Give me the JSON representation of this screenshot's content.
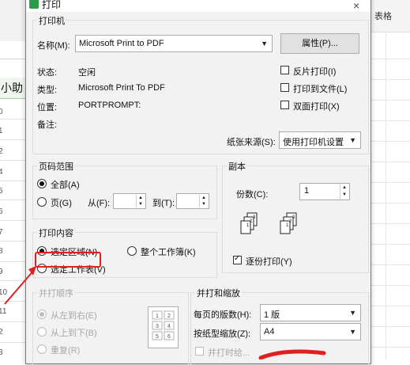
{
  "background": {
    "left_label": "小助",
    "row_numbers": [
      "0",
      "1",
      "2",
      "4",
      "5",
      "6",
      "7",
      "8",
      "9",
      "10",
      "11",
      "2",
      "3",
      "4"
    ],
    "right_label": "表格"
  },
  "dialog": {
    "title": "打印",
    "close": "×"
  },
  "printer": {
    "legend": "打印机",
    "name_label": "名称(M):",
    "name_value": "Microsoft Print to PDF",
    "properties_button": "属性(P)...",
    "status_label": "状态:",
    "status_value": "空闲",
    "type_label": "类型:",
    "type_value": "Microsoft Print To PDF",
    "location_label": "位置:",
    "location_value": "PORTPROMPT:",
    "comment_label": "备注:",
    "reverse_print": "反片打印(I)",
    "print_to_file": "打印到文件(L)",
    "duplex": "双面打印(X)",
    "paper_source_label": "纸张来源(S):",
    "paper_source_value": "使用打印机设置"
  },
  "page_range": {
    "legend": "页码范围",
    "all": "全部(A)",
    "pages": "页(G)",
    "from": "从(F):",
    "to": "到(T):"
  },
  "copies": {
    "legend": "副本",
    "count_label": "份数(C):",
    "count_value": "1",
    "collate": "逐份打印(Y)"
  },
  "print_content": {
    "legend": "打印内容",
    "selection": "选定区域(N)",
    "workbook": "整个工作簿(K)",
    "sheets": "选定工作表(V)"
  },
  "order": {
    "legend": "并打顺序",
    "left_to_right": "从左到右(E)",
    "top_to_bottom": "从上到下(B)",
    "repeat": "重复(R)"
  },
  "scaling": {
    "legend": "并打和缩放",
    "pages_per_sheet_label": "每页的版数(H):",
    "pages_per_sheet_value": "1 版",
    "scale_to_paper_label": "按纸型缩放(Z):",
    "scale_to_paper_value": "A4",
    "partial_label": "并打时给..."
  },
  "annotation_colors": {
    "highlight": "#e02020"
  }
}
